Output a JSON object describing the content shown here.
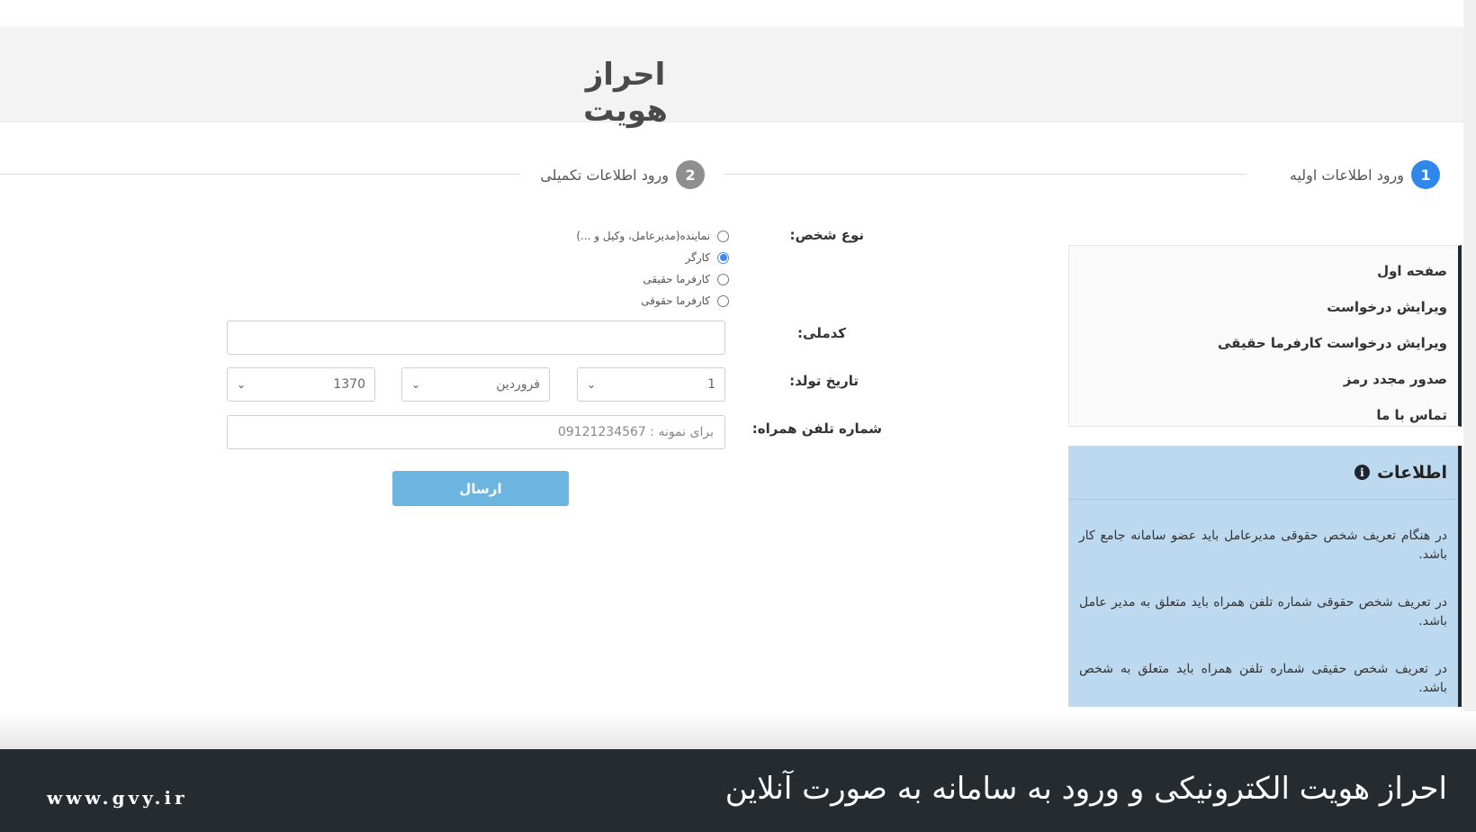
{
  "page_title": "احراز هویت",
  "stepper": {
    "step1": {
      "number": "1",
      "label": "ورود اطلاعات اولیه"
    },
    "step2": {
      "number": "2",
      "label": "ورود اطلاعات تکمیلی"
    }
  },
  "colors": {
    "step_active": "#2f86eb",
    "step_inactive": "#8f8f8f",
    "submit": "#6cb5e0",
    "info_bg": "#bcd9ef"
  },
  "form": {
    "person_type_label": "نوع شخص:",
    "person_types": [
      {
        "label": "نماینده(مدیرعامل، وکیل و ...)",
        "checked": false
      },
      {
        "label": "کارگر",
        "checked": true
      },
      {
        "label": "کارفرما حقیقی",
        "checked": false
      },
      {
        "label": "کارفرما حقوقی",
        "checked": false
      }
    ],
    "national_code_label": "کدملی:",
    "national_code_value": "",
    "birth_date_label": "تاریخ تولد:",
    "birth_day": "1",
    "birth_month": "فروردین",
    "birth_year": "1370",
    "mobile_label": "شماره تلفن همراه:",
    "mobile_placeholder": "برای نمونه : 09121234567",
    "submit_label": "ارسال"
  },
  "side_menu": {
    "items": [
      "صفحه اول",
      "ویرایش درخواست",
      "ویرایش درخواست کارفرما حقیقی",
      "صدور مجدد رمز",
      "تماس با ما"
    ]
  },
  "info": {
    "title": "اطلاعات",
    "icon": "info-icon",
    "paragraphs": [
      "در هنگام تعریف شخص حقوقی مدیرعامل باید عضو سامانه جامع کار باشد.",
      "در تعریف شخص حقوقی شماره تلفن همراه باید متعلق به مدیر عامل باشد.",
      "در تعریف شخص حقیقی شماره تلفن همراه باید متعلق به شخص باشد."
    ]
  },
  "caption": {
    "text": "احراز هویت الکترونیکی و ورود به سامانه به صورت آنلاین",
    "site": "www.gvy.ir"
  }
}
